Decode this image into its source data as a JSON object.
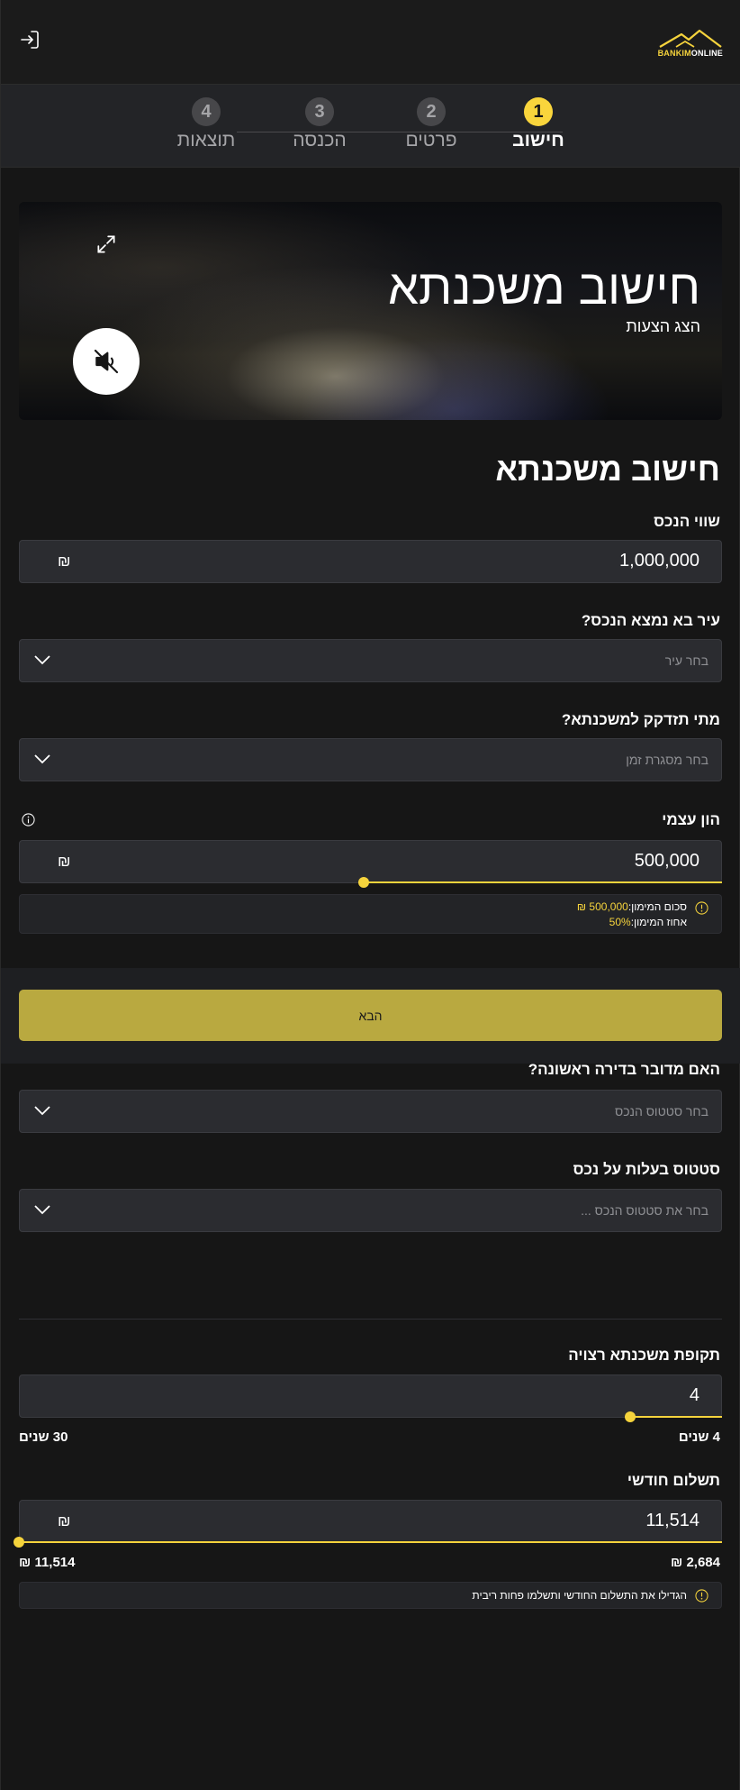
{
  "header": {
    "logo_part1": "BANKIM",
    "logo_part2": "ONLINE",
    "login_icon": "login-icon"
  },
  "stepper": {
    "steps": [
      {
        "number": "1",
        "label": "חישוב",
        "active": true
      },
      {
        "number": "2",
        "label": "פרטים",
        "active": false
      },
      {
        "number": "3",
        "label": "הכנסה",
        "active": false
      },
      {
        "number": "4",
        "label": "תוצאות",
        "active": false
      }
    ]
  },
  "hero": {
    "title": "חישוב משכנתא",
    "subtitle": "הצג הצעות",
    "icons": [
      "expand-icon",
      "mute-icon"
    ]
  },
  "form": {
    "title": "חישוב משכנתא",
    "property_value": {
      "label": "שווי הנכס",
      "value": "1,000,000",
      "currency": "₪"
    },
    "city": {
      "label": "עיר בא נמצא הנכס?",
      "placeholder": "בחר עיר"
    },
    "when_needed": {
      "label": "מתי תזדקק למשכנתא?",
      "placeholder": "בחר מסגרת זמן"
    },
    "equity": {
      "label": "הון עצמי",
      "value": "500,000",
      "currency": "₪",
      "slider_fraction": 0.51,
      "min_amount_label": "סכום המימון:",
      "min_amount_value": "500,000 ₪",
      "min_percent_label": "אחוז המימון:",
      "min_percent_value": "50%"
    },
    "first_apartment": {
      "label": "האם מדובר בדירה ראשונה?",
      "placeholder": "בחר סטטוס הנכס"
    },
    "ownership_status": {
      "label": "סטטוס בעלות על נכס",
      "placeholder": "בחר את סטטוס הנכס ..."
    },
    "period": {
      "label": "תקופת משכנתא רצויה",
      "value": "4",
      "slider_fraction": 0.13,
      "min_label": "4 שנים",
      "max_label": "30 שנים"
    },
    "monthly": {
      "label": "תשלום חודשי",
      "value": "11,514",
      "currency": "₪",
      "slider_fraction": 1.0,
      "min_label": "2,684 ₪",
      "max_label": "11,514 ₪",
      "hint": "הגדילו את התשלום החודשי ותשלמו פחות ריבית"
    }
  },
  "next_button": {
    "label": "הבא"
  },
  "colors": {
    "accent": "#f5d33c",
    "background": "#161616",
    "field": "#2b2c30",
    "button": "#b9a940"
  }
}
